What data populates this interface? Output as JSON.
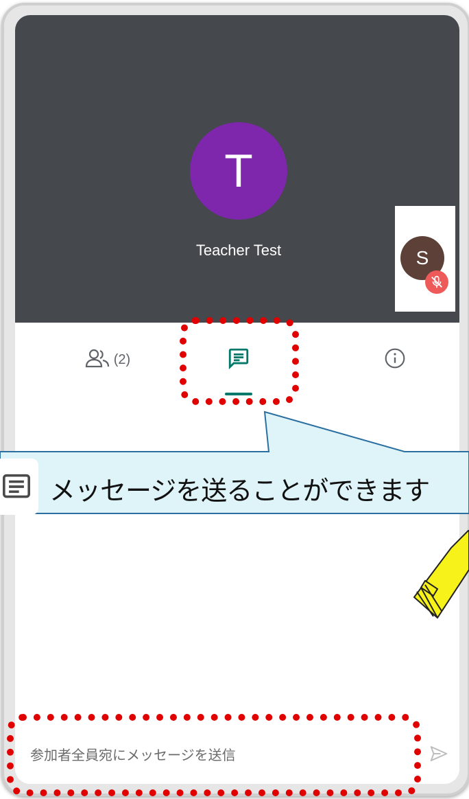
{
  "meeting": {
    "main_participant_initial": "T",
    "main_participant_name": "Teacher Test",
    "self_initial": "S",
    "colors": {
      "main_avatar": "#7e27ad",
      "self_avatar": "#5d4037",
      "mute_badge": "#ee5a5a",
      "accent": "#00796b",
      "video_bg": "#45484c"
    }
  },
  "tabs": {
    "people_count": "(2)",
    "people_icon": "people-icon",
    "chat_icon": "chat-icon",
    "info_icon": "info-icon",
    "selected": "chat"
  },
  "compose": {
    "placeholder": "参加者全員宛にメッセージを送信",
    "send_icon": "send-icon"
  },
  "annotation": {
    "callout_text": "メッセージを送ることができます",
    "callout_icon": "chat-icon"
  }
}
